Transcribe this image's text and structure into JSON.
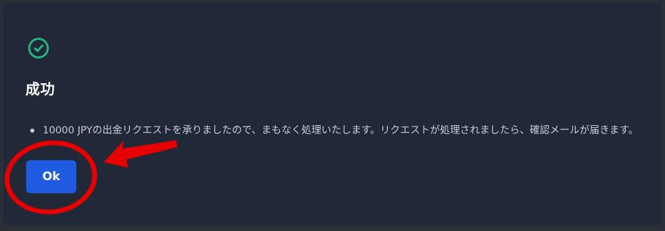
{
  "dialog": {
    "status_icon": "check-circle-icon",
    "title": "成功",
    "messages": [
      "10000 JPYの出金リクエストを承りましたので、まもなく処理いたします。リクエストが処理されましたら、確認メールが届きます。"
    ],
    "ok_button_label": "Ok"
  },
  "annotation": {
    "type": "red-circle-and-arrow",
    "target": "ok-button"
  },
  "colors": {
    "background": "#212938",
    "success_green": "#22b884",
    "button_blue": "#1f5be0",
    "annotation_red": "#e60000"
  }
}
